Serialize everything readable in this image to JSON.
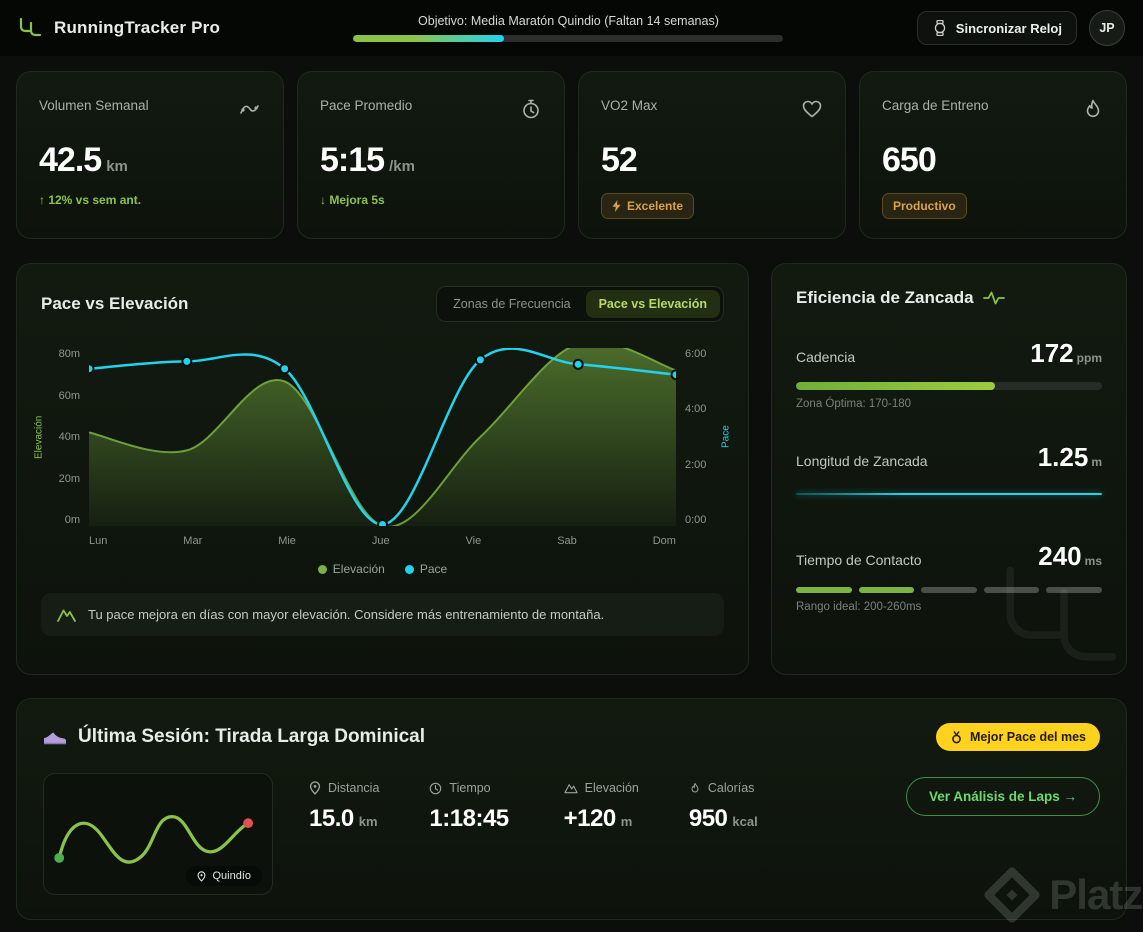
{
  "topbar": {
    "app_title": "RunningTracker Pro",
    "objective_text": "Objetivo: Media Maratón Quindio (Faltan 14 semanas)",
    "objective_progress_pct": 35,
    "sync_button_label": "Sincronizar Reloj",
    "avatar_initials": "JP"
  },
  "stats_cards": [
    {
      "label": "Volumen Semanal",
      "value": "42.5",
      "unit": "km",
      "delta": "↑ 12% vs sem ant.",
      "icon": "route-icon"
    },
    {
      "label": "Pace Promedio",
      "value": "5:15",
      "unit": "/km",
      "delta": "↓ Mejora 5s",
      "icon": "stopwatch-icon"
    },
    {
      "label": "VO2 Max",
      "value": "52",
      "badge": "Excelente",
      "icon": "heart-icon"
    },
    {
      "label": "Carga de Entreno",
      "value": "650",
      "badge": "Productivo",
      "icon": "flame-icon"
    }
  ],
  "chart_card": {
    "title": "Pace vs Elevación",
    "toggles": [
      {
        "label": "Zonas de Frecuencia",
        "active": false
      },
      {
        "label": "Pace vs Elevación",
        "active": true
      }
    ],
    "insight": "Tu pace mejora en días con mayor elevación. Considere más entrenamiento de montaña."
  },
  "chart_data": {
    "type": "combo",
    "categories": [
      "Lun",
      "Mar",
      "Mie",
      "Jue",
      "Vie",
      "Sab",
      "Dom"
    ],
    "series": [
      {
        "name": "Elevación",
        "type": "area",
        "axis": "left",
        "color": "#7cb342",
        "values": [
          42,
          34,
          65,
          0,
          40,
          82,
          70
        ]
      },
      {
        "name": "Pace",
        "type": "line",
        "axis": "right",
        "color": "#22d3ee",
        "values": [
          5.3,
          5.55,
          5.3,
          0.05,
          5.6,
          5.45,
          5.1
        ]
      }
    ],
    "left_axis": {
      "label": "Elevación",
      "min": 0,
      "max": 80,
      "ticks": [
        "0m",
        "20m",
        "40m",
        "60m",
        "80m"
      ],
      "color": "#8bc34a"
    },
    "right_axis": {
      "label": "Pace",
      "min": 0,
      "max": 6,
      "ticks": [
        "0:00",
        "2:00",
        "4:00",
        "6:00"
      ],
      "color": "#22d3ee"
    },
    "grid": false,
    "legend_position": "bottom"
  },
  "stride_card": {
    "title": "Eficiencia de Zancada",
    "cadence": {
      "label": "Cadencia",
      "value": "172",
      "unit": "ppm",
      "bar_pct": 65,
      "caption": "Zona Óptima: 170-180"
    },
    "stride_length": {
      "label": "Longitud de Zancada",
      "value": "1.25",
      "unit": "m"
    },
    "contact_time": {
      "label": "Tiempo de Contacto",
      "value": "240",
      "unit": "ms",
      "segments_total": 5,
      "segments_filled": 2,
      "caption": "Rango ideal: 200-260ms"
    }
  },
  "session_card": {
    "title": "Última Sesión: Tirada Larga Dominical",
    "badge": "Mejor Pace del mes",
    "map_tag": "Quindío",
    "stats": [
      {
        "label": "Distancia",
        "value": "15.0",
        "unit": "km",
        "icon": "pin-icon"
      },
      {
        "label": "Tiempo",
        "value": "1:18:45",
        "unit": "",
        "icon": "clock-icon"
      },
      {
        "label": "Elevación",
        "value": "+120",
        "unit": "m",
        "icon": "mountain-icon"
      },
      {
        "label": "Calorías",
        "value": "950",
        "unit": "kcal",
        "icon": "flame-icon"
      }
    ],
    "cta_label": "Ver Análisis de Laps →"
  },
  "watermark": "Platzi",
  "colors": {
    "accent_green": "#8bc34a",
    "accent_cyan": "#22d3ee",
    "badge_amber": "#dda04a",
    "highlight_yellow": "#ffd21f"
  }
}
